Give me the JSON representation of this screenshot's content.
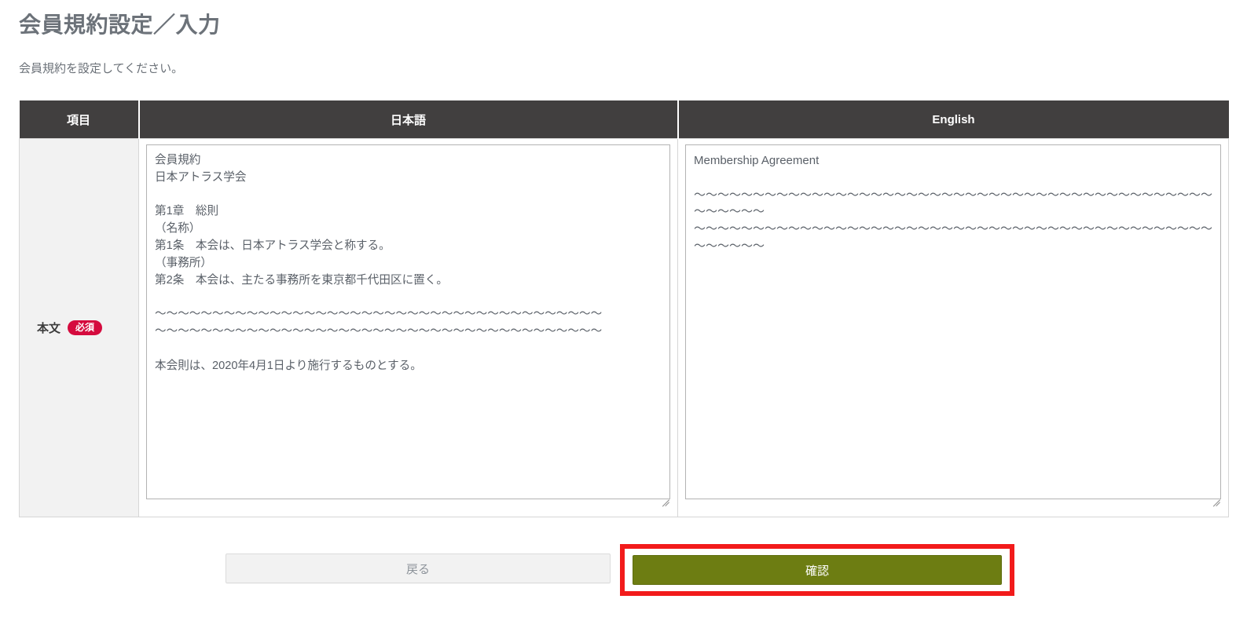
{
  "header": {
    "title": "会員規約設定／入力",
    "subtitle": "会員規約を設定してください。"
  },
  "table": {
    "headers": {
      "item": "項目",
      "japanese": "日本語",
      "english": "English"
    },
    "row": {
      "label": "本文",
      "required_badge": "必須",
      "japanese_value": "会員規約\n日本アトラス学会\n\n第1章　総則\n（名称）\n第1条　本会は、日本アトラス学会と称する。\n（事務所）\n第2条　本会は、主たる事務所を東京都千代田区に置く。\n\n～～～～～～～～～～～～～～～～～～～～～～～～～～～～～～～～～～～～～～～\n～～～～～～～～～～～～～～～～～～～～～～～～～～～～～～～～～～～～～～～\n\n本会則は、2020年4月1日より施行するものとする。",
      "english_value": "Membership Agreement\n\n～～～～～～～～～～～～～～～～～～～～～～～～～～～～～～～～～～～～～～～～～～～～～～～～～～\n～～～～～～～～～～～～～～～～～～～～～～～～～～～～～～～～～～～～～～～～～～～～～～～～～～",
      "japanese_placeholder": "",
      "english_placeholder": ""
    }
  },
  "footer": {
    "back_label": "戻る",
    "confirm_label": "確認"
  },
  "colors": {
    "header_bg": "#413f3f",
    "required_badge": "#d50b3e",
    "confirm_button": "#6d7d12",
    "highlight_border": "#f21b1b",
    "item_cell_bg": "#f2f2f2",
    "title_text": "#6c7279"
  }
}
